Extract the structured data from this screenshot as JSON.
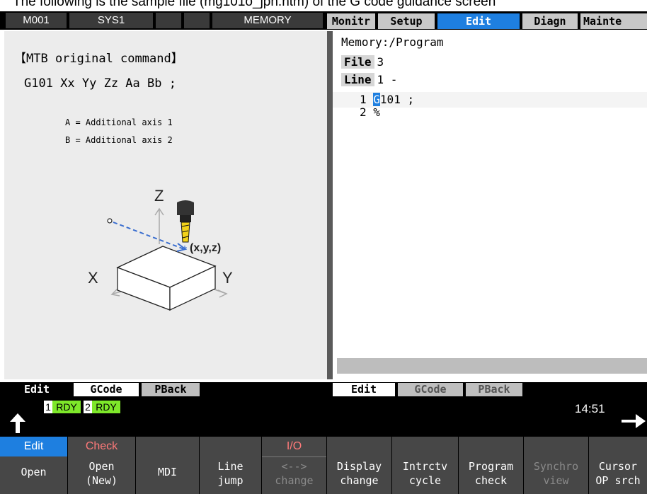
{
  "caption": "The following is the sample file (mg101o_jpn.htm) of the G code guidance screen",
  "topbar": {
    "cells": [
      "M001",
      "SYS1",
      "",
      "",
      "MEMORY"
    ],
    "menu_tabs": [
      "Monitr",
      "Setup",
      "Edit",
      "Diagn",
      "Mainte"
    ],
    "active_tab": "Edit"
  },
  "left": {
    "heading": "【MTB original command】",
    "command": "G101 Xx Yy Zz Aa Bb ;",
    "notes": [
      "A = Additional axis 1",
      "B = Additional axis 2"
    ],
    "figure": {
      "z_label": "Z",
      "x_label": "X",
      "y_label": "Y",
      "point_label": "(x,y,z)"
    }
  },
  "right": {
    "path": "Memory:/Program",
    "file_label": "File",
    "file_value": "3",
    "line_label": "Line",
    "line_value": "1 -",
    "program_lines": [
      {
        "num": "1",
        "cursor": "G",
        "text": "101 ;"
      },
      {
        "num": "2",
        "cursor": "",
        "text": "%"
      }
    ]
  },
  "left_modes": [
    "Edit",
    "GCode",
    "PBack"
  ],
  "right_modes": [
    "Edit",
    "GCode",
    "PBack"
  ],
  "status": {
    "rdy1_num": "1",
    "rdy1": "RDY",
    "rdy2_num": "2",
    "rdy2": "RDY",
    "time": "14:51",
    "back_icon": "up-arrow-icon",
    "next_icon": "right-arrow-icon"
  },
  "fkeys": [
    {
      "top": "Edit",
      "bottom": "Open"
    },
    {
      "top": "Check",
      "bottom": "Open\n(New)"
    },
    {
      "top": "",
      "bottom": "MDI"
    },
    {
      "top": "",
      "bottom": "Line\njump"
    },
    {
      "top": "I/O",
      "bottom": "<-->\nchange"
    },
    {
      "top": "",
      "bottom": "Display\nchange"
    },
    {
      "top": "",
      "bottom": "Intrctv\ncycle"
    },
    {
      "top": "",
      "bottom": "Program\ncheck"
    },
    {
      "top": "",
      "bottom": "Synchro\nview"
    },
    {
      "top": "",
      "bottom": "Cursor\nOP srch"
    }
  ],
  "colors": {
    "accent": "#1e7fe0",
    "rdy_green": "#7ee82a",
    "check_red": "#ff7a7a",
    "tool_yellow": "#f2d21a"
  }
}
